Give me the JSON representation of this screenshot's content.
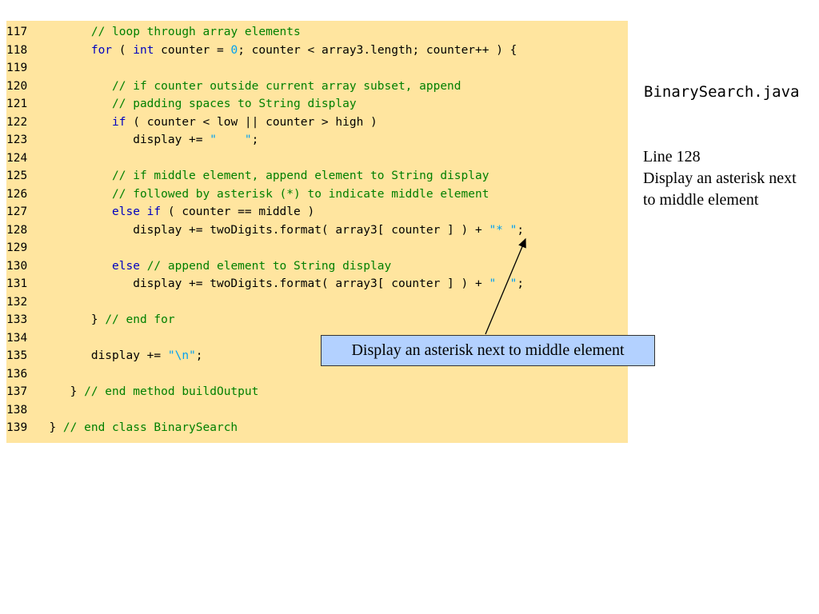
{
  "code": {
    "lines": [
      {
        "num": "117",
        "tokens": [
          {
            "t": "        "
          },
          {
            "t": "// loop through array elements",
            "c": "cm"
          }
        ]
      },
      {
        "num": "118",
        "tokens": [
          {
            "t": "        "
          },
          {
            "t": "for",
            "c": "kw"
          },
          {
            "t": " ( "
          },
          {
            "t": "int",
            "c": "kw"
          },
          {
            "t": " counter = "
          },
          {
            "t": "0",
            "c": "num"
          },
          {
            "t": "; counter < array3.length; counter++ ) {"
          }
        ]
      },
      {
        "num": "119",
        "tokens": []
      },
      {
        "num": "120",
        "tokens": [
          {
            "t": "           "
          },
          {
            "t": "// if counter outside current array subset, append",
            "c": "cm"
          }
        ]
      },
      {
        "num": "121",
        "tokens": [
          {
            "t": "           "
          },
          {
            "t": "// padding spaces to String display",
            "c": "cm"
          }
        ]
      },
      {
        "num": "122",
        "tokens": [
          {
            "t": "           "
          },
          {
            "t": "if",
            "c": "kw"
          },
          {
            "t": " ( counter < low || counter > high )"
          }
        ]
      },
      {
        "num": "123",
        "tokens": [
          {
            "t": "              display += "
          },
          {
            "t": "\"    \"",
            "c": "str"
          },
          {
            "t": ";"
          }
        ]
      },
      {
        "num": "124",
        "tokens": []
      },
      {
        "num": "125",
        "tokens": [
          {
            "t": "           "
          },
          {
            "t": "// if middle element, append element to String display",
            "c": "cm"
          }
        ]
      },
      {
        "num": "126",
        "tokens": [
          {
            "t": "           "
          },
          {
            "t": "// followed by asterisk (*) to indicate middle element",
            "c": "cm"
          }
        ]
      },
      {
        "num": "127",
        "tokens": [
          {
            "t": "           "
          },
          {
            "t": "else if",
            "c": "kw"
          },
          {
            "t": " ( counter == middle )"
          }
        ]
      },
      {
        "num": "128",
        "tokens": [
          {
            "t": "              display += twoDigits.format( array3[ counter ] ) + "
          },
          {
            "t": "\"* \"",
            "c": "str"
          },
          {
            "t": ";"
          }
        ]
      },
      {
        "num": "129",
        "tokens": []
      },
      {
        "num": "130",
        "tokens": [
          {
            "t": "           "
          },
          {
            "t": "else",
            "c": "kw"
          },
          {
            "t": " "
          },
          {
            "t": "// append element to String display",
            "c": "cm"
          }
        ]
      },
      {
        "num": "131",
        "tokens": [
          {
            "t": "              display += twoDigits.format( array3[ counter ] ) + "
          },
          {
            "t": "\"  \"",
            "c": "str"
          },
          {
            "t": ";"
          }
        ]
      },
      {
        "num": "132",
        "tokens": []
      },
      {
        "num": "133",
        "tokens": [
          {
            "t": "        } "
          },
          {
            "t": "// end for",
            "c": "cm"
          }
        ]
      },
      {
        "num": "134",
        "tokens": []
      },
      {
        "num": "135",
        "tokens": [
          {
            "t": "        display += "
          },
          {
            "t": "\"\\n\"",
            "c": "str"
          },
          {
            "t": ";"
          }
        ]
      },
      {
        "num": "136",
        "tokens": []
      },
      {
        "num": "137",
        "tokens": [
          {
            "t": "     } "
          },
          {
            "t": "// end method buildOutput",
            "c": "cm"
          }
        ]
      },
      {
        "num": "138",
        "tokens": []
      },
      {
        "num": "139",
        "tokens": [
          {
            "t": "  } "
          },
          {
            "t": "// end class BinarySearch",
            "c": "cm"
          }
        ]
      }
    ]
  },
  "sidebar": {
    "file_name": "BinarySearch.java",
    "line_ref": "Line 128",
    "description": "Display an asterisk next to middle element"
  },
  "callout": {
    "text": "Display an asterisk next to middle element"
  },
  "colors": {
    "panel_bg": "#ffe59f",
    "keyword": "#0000c0",
    "comment": "#008000",
    "string_literal": "#00a0f0",
    "callout_bg": "#b3d1ff"
  }
}
